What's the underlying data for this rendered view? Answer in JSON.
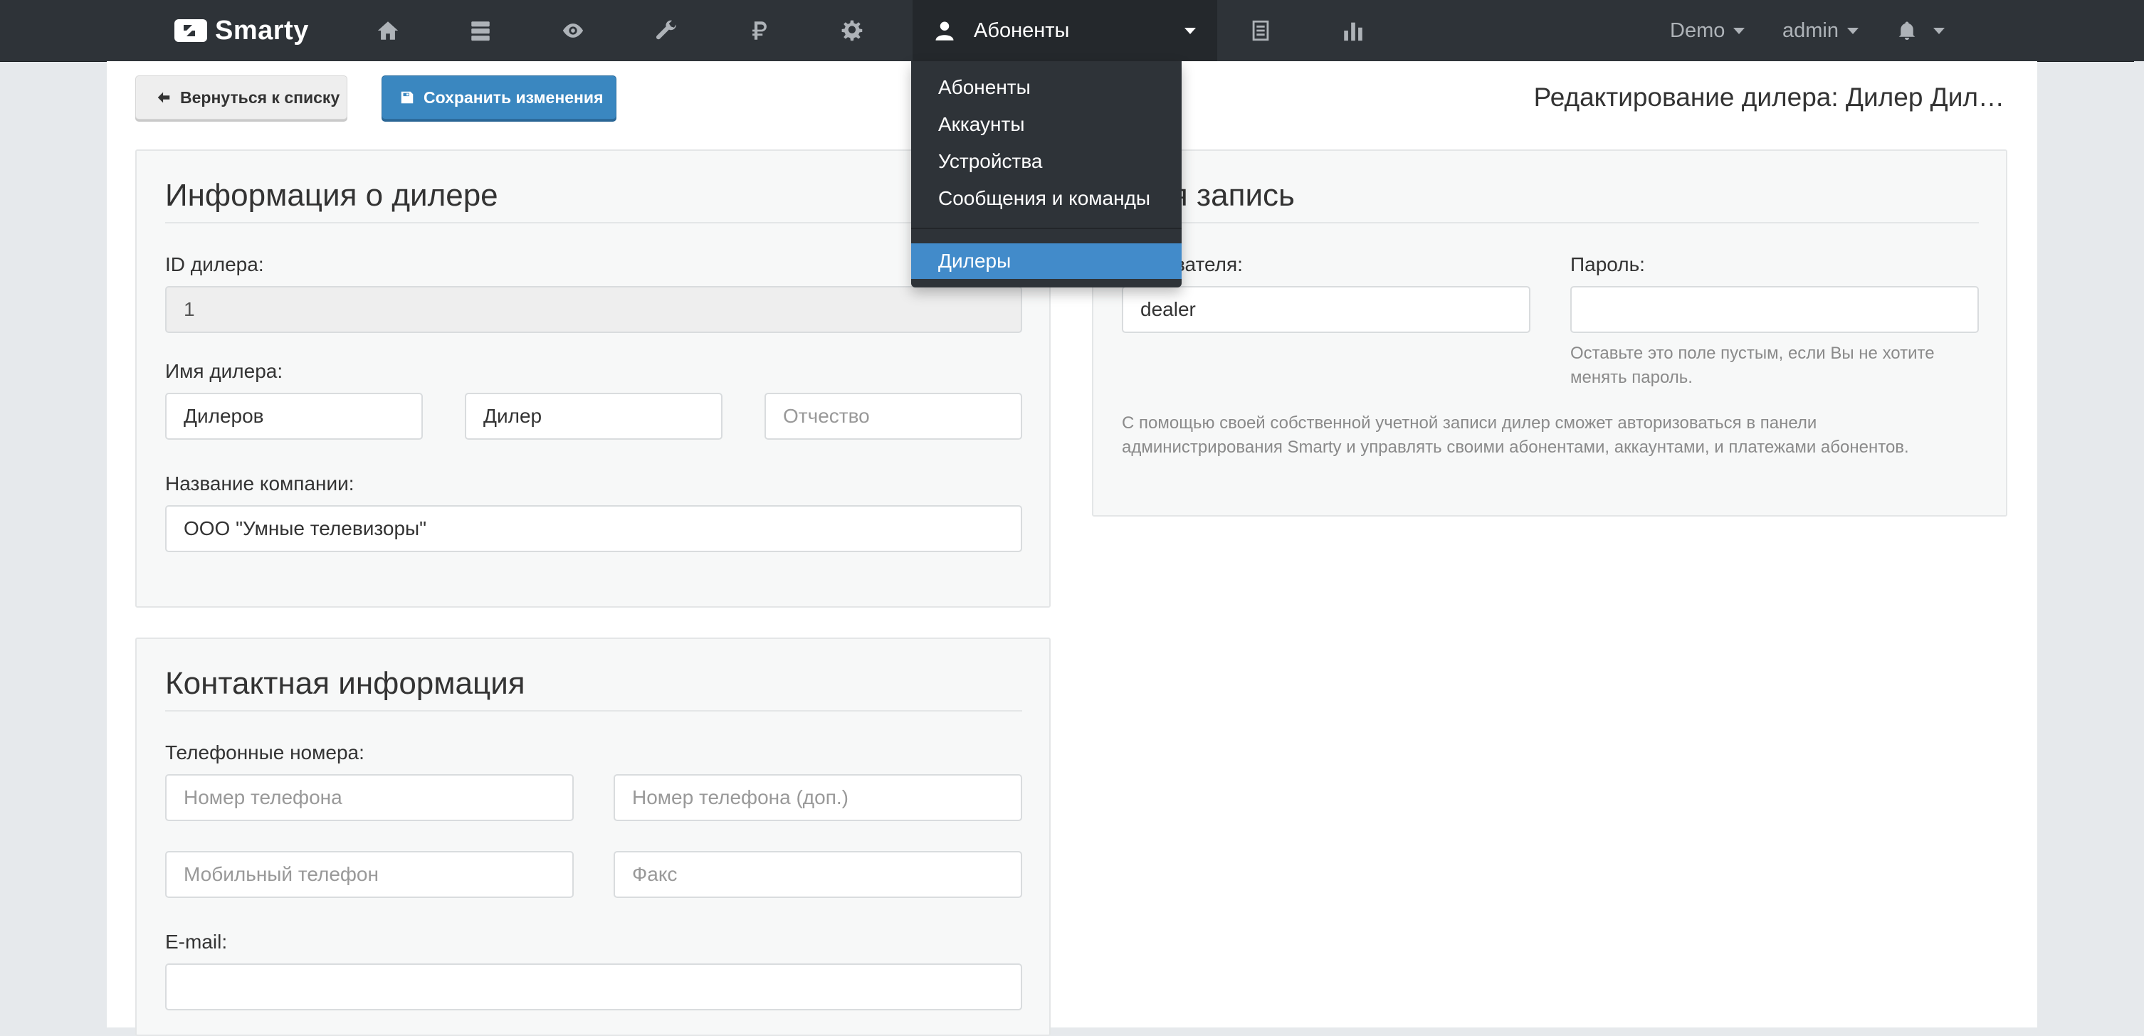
{
  "navbar": {
    "brand": "Smarty",
    "icons": [
      "home-icon",
      "server-icon",
      "eye-icon",
      "wrench-icon",
      "ruble-icon",
      "gear-icon"
    ],
    "active_menu": "Абоненты",
    "after_icons": [
      "table-icon",
      "bar-chart-icon"
    ],
    "demo_label": "Demo",
    "user_label": "admin",
    "bell_icon": "bell-icon"
  },
  "dropdown": {
    "items": [
      "Абоненты",
      "Аккаунты",
      "Устройства",
      "Сообщения и команды"
    ],
    "active_item": "Дилеры"
  },
  "toolbar": {
    "back_label": "Вернуться к списку",
    "save_label": "Сохранить изменения"
  },
  "page_title": "Редактирование дилера: Дилер Дил…",
  "dealer_info": {
    "title": "Информация о дилере",
    "id_label": "ID дилера:",
    "id_value": "1",
    "name_label": "Имя дилера:",
    "last_name": "Дилеров",
    "first_name": "Дилер",
    "middle_name_placeholder": "Отчество",
    "company_label": "Название компании:",
    "company_value": "ООО \"Умные телевизоры\""
  },
  "account": {
    "title": "тная запись",
    "username_label": "ользователя:",
    "username_value": "dealer",
    "password_label": "Пароль:",
    "password_help": "Оставьте это поле пустым, если Вы не хотите менять пароль.",
    "description": "С помощью своей собственной учетной записи дилер сможет авторизоваться в панели администрирования Smarty и управлять своими абонентами, аккаунтами, и платежами абонентов."
  },
  "contact": {
    "title": "Контактная информация",
    "phones_label": "Телефонные номера:",
    "phone_placeholder": "Номер телефона",
    "phone_ext_placeholder": "Номер телефона (доп.)",
    "mobile_placeholder": "Мобильный телефон",
    "fax_placeholder": "Факс",
    "email_label": "E-mail:"
  },
  "colors": {
    "navbar_bg": "#2e3338",
    "primary": "#3a87c0",
    "active_item": "#428bca"
  }
}
